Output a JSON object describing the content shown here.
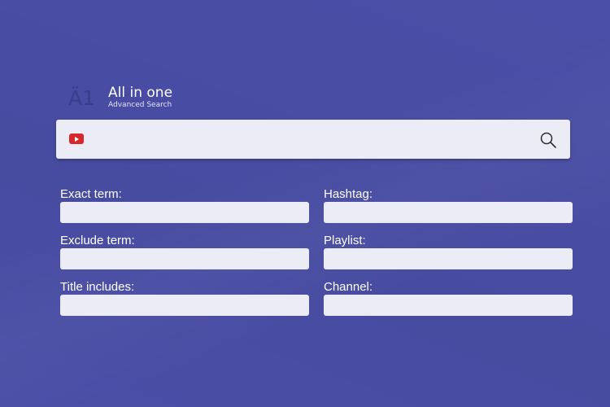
{
  "brand": {
    "mark": "Ä1",
    "title": "All in one",
    "subtitle": "Advanced Search"
  },
  "search": {
    "value": "",
    "placeholder": "",
    "platform_icon": "youtube-icon",
    "submit_icon": "search-icon"
  },
  "fields": {
    "exact_term": {
      "label": "Exact term:",
      "value": ""
    },
    "hashtag": {
      "label": "Hashtag:",
      "value": ""
    },
    "exclude_term": {
      "label": "Exclude term:",
      "value": ""
    },
    "playlist": {
      "label": "Playlist:",
      "value": ""
    },
    "title_includes": {
      "label": "Title includes:",
      "value": ""
    },
    "channel": {
      "label": "Channel:",
      "value": ""
    }
  },
  "colors": {
    "background": "#4a4ea6",
    "input_background": "#ececf6",
    "youtube_red": "#d6282b",
    "logo_mark": "#3a3d8a"
  }
}
